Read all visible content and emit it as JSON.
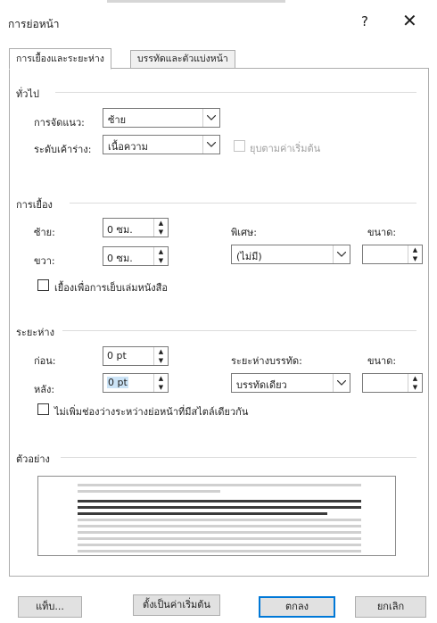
{
  "dialog": {
    "title": "การย่อหน้า",
    "help": "?",
    "close": "✕"
  },
  "tabs": [
    {
      "label": "การเยื้องและระยะห่าง",
      "active": true
    },
    {
      "label": "บรรทัดและตัวแบ่งหน้า",
      "active": false
    }
  ],
  "general": {
    "heading": "ทั่วไป",
    "alignment_label": "การจัดแนว:",
    "alignment_value": "ซ้าย",
    "outline_label": "ระดับเค้าร่าง:",
    "outline_value": "เนื้อความ",
    "collapsed_label": "ยุบตามค่าเริ่มต้น"
  },
  "indentation": {
    "heading": "การเยื้อง",
    "left_label": "ซ้าย:",
    "left_value": "0 ซม.",
    "right_label": "ขวา:",
    "right_value": "0 ซม.",
    "special_label": "พิเศษ:",
    "special_value": "(ไม่มี)",
    "by_label": "ขนาด:",
    "by_value": "",
    "mirror_label": "เยื้องเพื่อการเย็บเล่มหนังสือ"
  },
  "spacing": {
    "heading": "ระยะห่าง",
    "before_label": "ก่อน:",
    "before_value": "0 pt",
    "after_label": "หลัง:",
    "after_value": "0 pt",
    "line_spacing_label": "ระยะห่างบรรทัด:",
    "line_spacing_value": "บรรทัดเดียว",
    "at_label": "ขนาด:",
    "at_value": "",
    "dont_add_label": "ไม่เพิ่มช่องว่างระหว่างย่อหน้าที่มีสไตล์เดียวกัน"
  },
  "preview": {
    "heading": "ตัวอย่าง"
  },
  "buttons": {
    "tabs": "แท็บ...",
    "set_default": "ตั้งเป็นค่าเริ่มต้น",
    "ok": "ตกลง",
    "cancel": "ยกเลิก"
  },
  "colors": {
    "accent": "#0078d7",
    "selection": "#cce4f7",
    "preview_grey": "#c8c8c8",
    "preview_dark": "#333333"
  }
}
